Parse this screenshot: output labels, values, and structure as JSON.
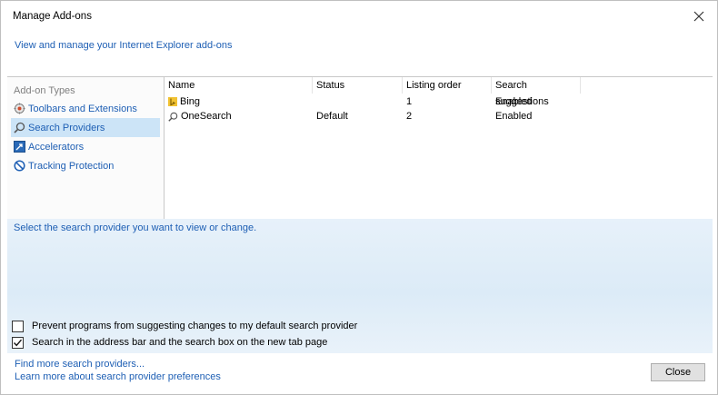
{
  "window": {
    "title": "Manage Add-ons",
    "header_link": "View and manage your Internet Explorer add-ons"
  },
  "sidebar": {
    "header": "Add-on Types",
    "items": [
      {
        "label": "Toolbars and Extensions",
        "icon": "gear-icon",
        "selected": false
      },
      {
        "label": "Search Providers",
        "icon": "search-icon",
        "selected": true
      },
      {
        "label": "Accelerators",
        "icon": "accelerator-icon",
        "selected": false
      },
      {
        "label": "Tracking Protection",
        "icon": "tracking-protection-icon",
        "selected": false
      }
    ]
  },
  "table": {
    "columns": [
      "Name",
      "Status",
      "Listing order",
      "Search suggestions"
    ],
    "rows": [
      {
        "name": "Bing",
        "icon": "bing-icon",
        "status": "",
        "order": "1",
        "suggestions": "Enabled"
      },
      {
        "name": "OneSearch",
        "icon": "search-icon",
        "status": "Default",
        "order": "2",
        "suggestions": "Enabled"
      }
    ]
  },
  "details": {
    "prompt": "Select the search provider you want to view or change.",
    "checkboxes": [
      {
        "label": "Prevent programs from suggesting changes to my default search provider",
        "checked": false
      },
      {
        "label": "Search in the address bar and the search box on the new tab page",
        "checked": true
      }
    ]
  },
  "footer": {
    "links": [
      "Find more search providers...",
      "Learn more about search provider preferences"
    ],
    "close_label": "Close"
  },
  "colors": {
    "link": "#1e5fb4",
    "selection": "#cce4f7"
  }
}
